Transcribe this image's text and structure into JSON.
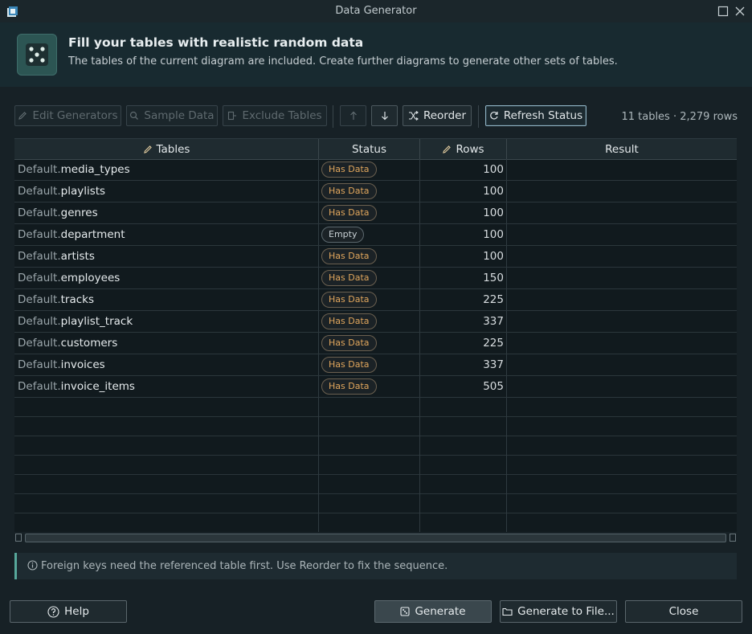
{
  "window": {
    "title": "Data Generator"
  },
  "header": {
    "title": "Fill your tables with realistic random data",
    "subtitle": "The tables of the current diagram are included. Create further diagrams to generate other sets of tables."
  },
  "toolbar": {
    "edit_generators": "Edit Generators",
    "sample_data": "Sample Data",
    "exclude_tables": "Exclude Tables",
    "reorder": "Reorder",
    "refresh_status": "Refresh Status",
    "summary": "11 tables · 2,279 rows"
  },
  "grid": {
    "columns": {
      "tables": "Tables",
      "status": "Status",
      "rows": "Rows",
      "result": "Result"
    },
    "rows": [
      {
        "schema": "Default.",
        "name": "media_types",
        "status": "Has Data",
        "rows": "100",
        "result": ""
      },
      {
        "schema": "Default.",
        "name": "playlists",
        "status": "Has Data",
        "rows": "100",
        "result": ""
      },
      {
        "schema": "Default.",
        "name": "genres",
        "status": "Has Data",
        "rows": "100",
        "result": ""
      },
      {
        "schema": "Default.",
        "name": "department",
        "status": "Empty",
        "rows": "100",
        "result": ""
      },
      {
        "schema": "Default.",
        "name": "artists",
        "status": "Has Data",
        "rows": "100",
        "result": ""
      },
      {
        "schema": "Default.",
        "name": "employees",
        "status": "Has Data",
        "rows": "150",
        "result": ""
      },
      {
        "schema": "Default.",
        "name": "tracks",
        "status": "Has Data",
        "rows": "225",
        "result": ""
      },
      {
        "schema": "Default.",
        "name": "playlist_track",
        "status": "Has Data",
        "rows": "337",
        "result": ""
      },
      {
        "schema": "Default.",
        "name": "customers",
        "status": "Has Data",
        "rows": "225",
        "result": ""
      },
      {
        "schema": "Default.",
        "name": "invoices",
        "status": "Has Data",
        "rows": "337",
        "result": ""
      },
      {
        "schema": "Default.",
        "name": "invoice_items",
        "status": "Has Data",
        "rows": "505",
        "result": ""
      }
    ]
  },
  "info": {
    "text": "Foreign keys need the referenced table first. Use Reorder to fix the sequence."
  },
  "footer": {
    "help": "Help",
    "generate": "Generate",
    "generate_to_file": "Generate to File...",
    "close": "Close"
  },
  "colors": {
    "accent": "#57a89b",
    "badge_has_data": "#e2a75d",
    "background": "#172126"
  }
}
